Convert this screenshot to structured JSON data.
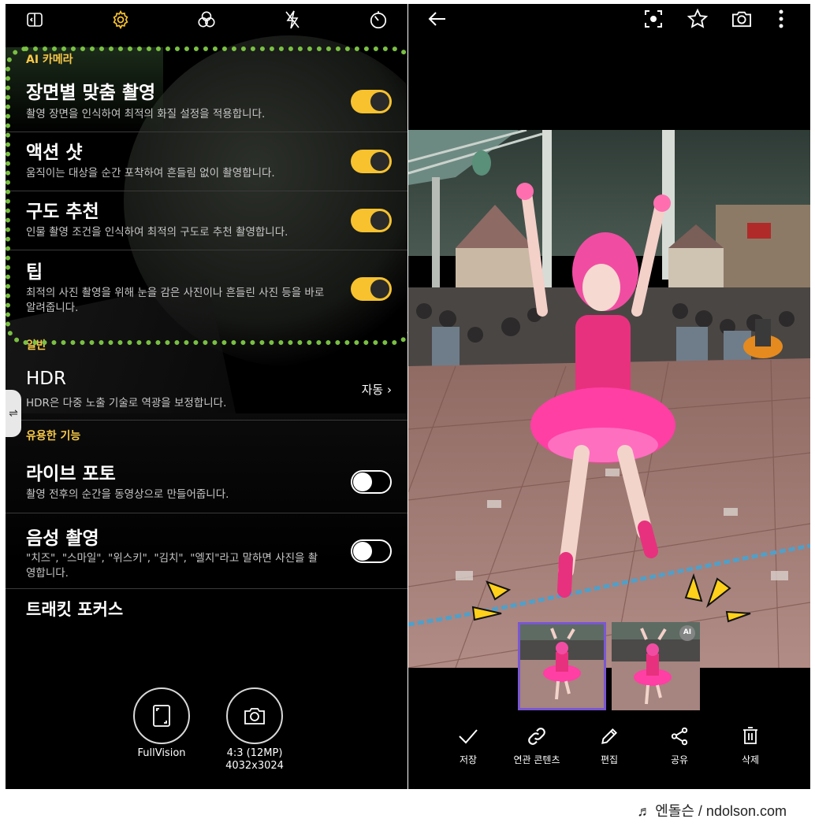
{
  "settings_panel": {
    "top_icons": [
      "aspect-toggle-icon",
      "gear-icon",
      "filter-effects-icon",
      "flash-off-icon",
      "timer-icon"
    ],
    "sections": [
      {
        "title": "AI 카메라",
        "rows": [
          {
            "title": "장면별 맞춤 촬영",
            "desc": "촬영 장면을 인식하여 최적의 화질 설정을 적용합니다.",
            "toggle": "on"
          },
          {
            "title": "액션 샷",
            "desc": "움직이는 대상을 순간 포착하여 흔들림 없이 촬영합니다.",
            "toggle": "on"
          },
          {
            "title": "구도 추천",
            "desc": "인물 촬영 조건을 인식하여 최적의 구도로 추천 촬영합니다.",
            "toggle": "on"
          },
          {
            "title": "팁",
            "desc": "최적의 사진 촬영을 위해 눈을 감은 사진이나 흔들린 사진 등을 바로 알려줍니다.",
            "toggle": "on"
          }
        ]
      },
      {
        "title": "일반",
        "rows": [
          {
            "title": "HDR",
            "desc": "HDR은 다중 노출 기술로 역광을 보정합니다.",
            "value": "자동 ›"
          }
        ]
      },
      {
        "title": "유용한 기능",
        "rows": [
          {
            "title": "라이브 포토",
            "desc": "촬영 전후의 순간을 동영상으로 만들어줍니다.",
            "toggle": "off"
          },
          {
            "title": "음성 촬영",
            "desc": "\"치즈\", \"스마일\", \"위스키\", \"김치\", \"엘지\"라고 말하면 사진을 촬영합니다.",
            "toggle": "off"
          },
          {
            "title": "트래킷 포커스",
            "desc": ""
          }
        ]
      }
    ],
    "bottom_buttons": [
      {
        "icon": "fullvision-icon",
        "label": "FullVision"
      },
      {
        "icon": "camera-icon",
        "label": "4:3 (12MP)",
        "label2": "4032x3024"
      }
    ],
    "side_handle": "⇌",
    "highlight_color": "#7ac043",
    "accent_color": "#f7c22e"
  },
  "gallery": {
    "top_icons": [
      "back-arrow-icon",
      "focus-scan-icon",
      "star-icon",
      "camera-icon",
      "more-vert-icon"
    ],
    "thumbnails": [
      {
        "selected": true,
        "badge": ""
      },
      {
        "selected": false,
        "badge": "AI"
      }
    ],
    "actions": [
      {
        "icon": "check-icon",
        "label": "저장"
      },
      {
        "icon": "link-icon",
        "label": "연관 콘텐츠"
      },
      {
        "icon": "pencil-icon",
        "label": "편집"
      },
      {
        "icon": "share-icon",
        "label": "공유"
      },
      {
        "icon": "trash-icon",
        "label": "삭제"
      }
    ],
    "thumb_border_color": "#7a57d1"
  },
  "credit": "♬ 엔돌슨 / ndolson.com"
}
